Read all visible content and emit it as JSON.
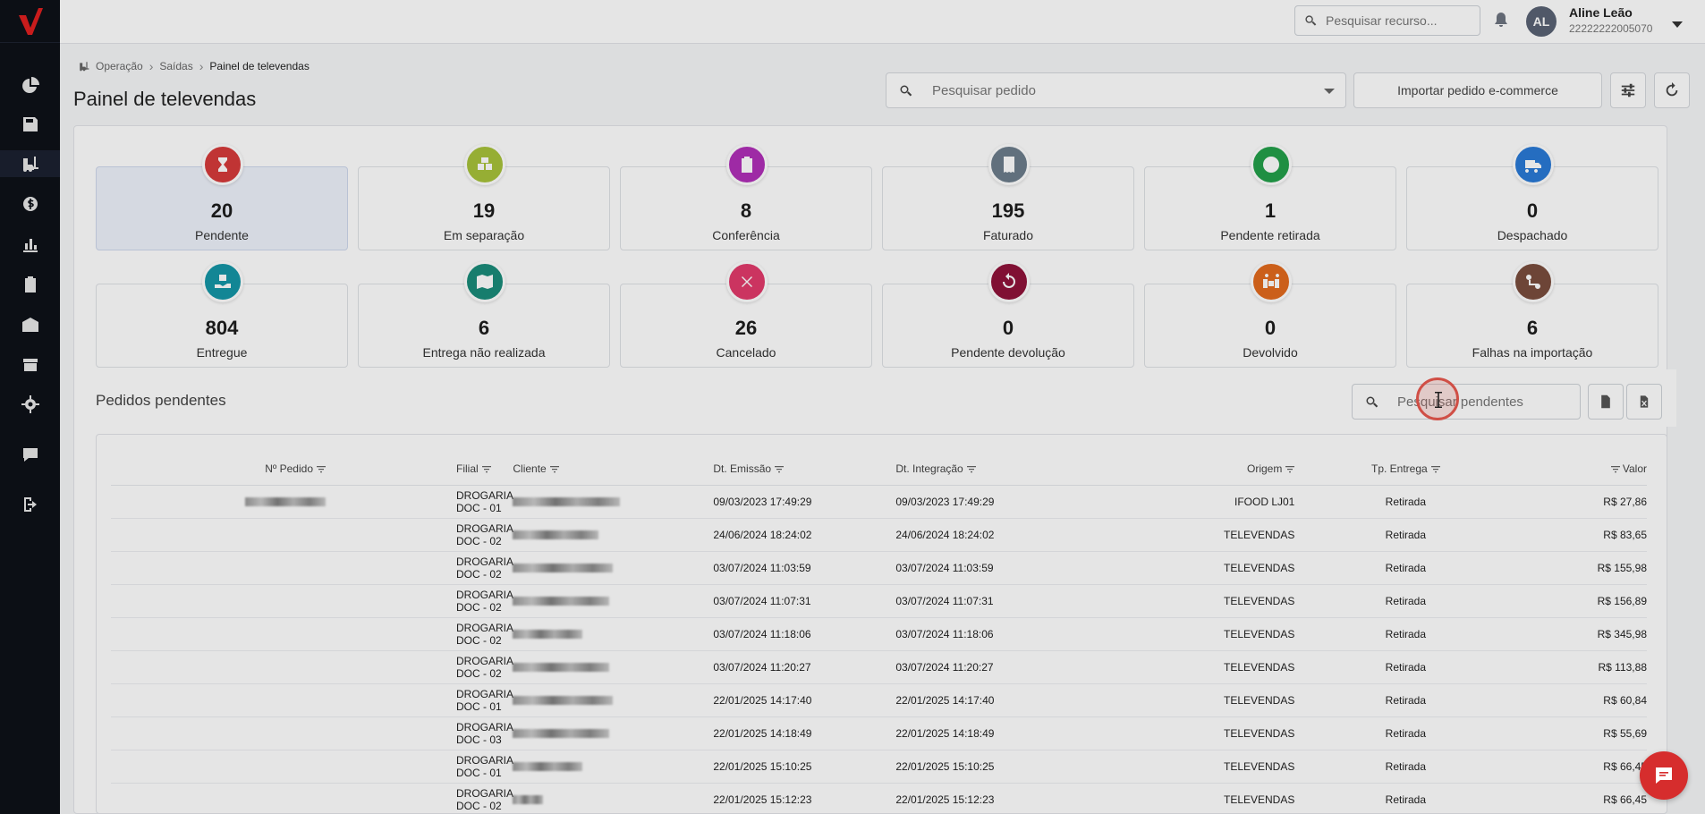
{
  "header": {
    "search_placeholder": "Pesquisar recurso...",
    "user": {
      "initials": "AL",
      "name": "Aline Leão",
      "id": "22222222005070"
    }
  },
  "breadcrumb": [
    "Operação",
    "Saídas",
    "Painel de televendas"
  ],
  "page": {
    "title": "Painel de televendas",
    "order_search_placeholder": "Pesquisar pedido",
    "import_label": "Importar pedido e-commerce"
  },
  "colors": {
    "pendente": "#d63a3a",
    "em_separacao": "#a8c23a",
    "conferencia": "#b02fb8",
    "faturado": "#6c7d8c",
    "pendente_retirada": "#23a04a",
    "despachado": "#2a7ad6",
    "entregue": "#1596a6",
    "entrega_nao_realizada": "#1a8c7a",
    "cancelado": "#e23a6b",
    "pendente_devolucao": "#8f1239",
    "devolvido": "#e36a1e",
    "falhas_importacao": "#7a4d3e",
    "chat": "#d62d2d"
  },
  "status_cards": [
    {
      "count": "20",
      "label": "Pendente",
      "icon": "hourglass-icon",
      "color": "#d63a3a"
    },
    {
      "count": "19",
      "label": "Em separação",
      "icon": "boxes-icon",
      "color": "#a8c23a"
    },
    {
      "count": "8",
      "label": "Conferência",
      "icon": "clipboard-icon",
      "color": "#b02fb8"
    },
    {
      "count": "195",
      "label": "Faturado",
      "icon": "receipt-icon",
      "color": "#6c7d8c"
    },
    {
      "count": "1",
      "label": "Pendente retirada",
      "icon": "clock-icon",
      "color": "#23a04a"
    },
    {
      "count": "0",
      "label": "Despachado",
      "icon": "truck-icon",
      "color": "#2a7ad6"
    },
    {
      "count": "804",
      "label": "Entregue",
      "icon": "hand-box-icon",
      "color": "#1596a6"
    },
    {
      "count": "6",
      "label": "Entrega não realizada",
      "icon": "map-icon",
      "color": "#1a8c7a"
    },
    {
      "count": "26",
      "label": "Cancelado",
      "icon": "cancel-icon",
      "color": "#e23a6b"
    },
    {
      "count": "0",
      "label": "Pendente devolução",
      "icon": "undo-icon",
      "color": "#8f1239"
    },
    {
      "count": "0",
      "label": "Devolvido",
      "icon": "people-box-icon",
      "color": "#e36a1e"
    },
    {
      "count": "6",
      "label": "Falhas na importação",
      "icon": "route-icon",
      "color": "#7a4d3e"
    }
  ],
  "pending": {
    "title": "Pedidos pendentes",
    "search_placeholder": "Pesquisar pendentes"
  },
  "table": {
    "columns": [
      "Nº Pedido",
      "Filial",
      "Cliente",
      "Dt. Emissão",
      "Dt. Integração",
      "Origem",
      "Tp. Entrega",
      "Valor"
    ],
    "rows": [
      {
        "filial": "DROGARIA DOC - 01",
        "emissao": "09/03/2023 17:49:29",
        "integracao": "09/03/2023 17:49:29",
        "origem": "IFOOD LJ01",
        "entrega": "Retirada",
        "valor": "R$ 27,86"
      },
      {
        "filial": "DROGARIA DOC - 02",
        "emissao": "24/06/2024 18:24:02",
        "integracao": "24/06/2024 18:24:02",
        "origem": "TELEVENDAS",
        "entrega": "Retirada",
        "valor": "R$ 83,65"
      },
      {
        "filial": "DROGARIA DOC - 02",
        "emissao": "03/07/2024 11:03:59",
        "integracao": "03/07/2024 11:03:59",
        "origem": "TELEVENDAS",
        "entrega": "Retirada",
        "valor": "R$ 155,98"
      },
      {
        "filial": "DROGARIA DOC - 02",
        "emissao": "03/07/2024 11:07:31",
        "integracao": "03/07/2024 11:07:31",
        "origem": "TELEVENDAS",
        "entrega": "Retirada",
        "valor": "R$ 156,89"
      },
      {
        "filial": "DROGARIA DOC - 02",
        "emissao": "03/07/2024 11:18:06",
        "integracao": "03/07/2024 11:18:06",
        "origem": "TELEVENDAS",
        "entrega": "Retirada",
        "valor": "R$ 345,98"
      },
      {
        "filial": "DROGARIA DOC - 02",
        "emissao": "03/07/2024 11:20:27",
        "integracao": "03/07/2024 11:20:27",
        "origem": "TELEVENDAS",
        "entrega": "Retirada",
        "valor": "R$ 113,88"
      },
      {
        "filial": "DROGARIA DOC - 01",
        "emissao": "22/01/2025 14:17:40",
        "integracao": "22/01/2025 14:17:40",
        "origem": "TELEVENDAS",
        "entrega": "Retirada",
        "valor": "R$ 60,84"
      },
      {
        "filial": "DROGARIA DOC - 03",
        "emissao": "22/01/2025 14:18:49",
        "integracao": "22/01/2025 14:18:49",
        "origem": "TELEVENDAS",
        "entrega": "Retirada",
        "valor": "R$ 55,69"
      },
      {
        "filial": "DROGARIA DOC - 01",
        "emissao": "22/01/2025 15:10:25",
        "integracao": "22/01/2025 15:10:25",
        "origem": "TELEVENDAS",
        "entrega": "Retirada",
        "valor": "R$ 66,45"
      },
      {
        "filial": "DROGARIA DOC - 02",
        "emissao": "22/01/2025 15:12:23",
        "integracao": "22/01/2025 15:12:23",
        "origem": "TELEVENDAS",
        "entrega": "Retirada",
        "valor": "R$ 66,45"
      }
    ]
  }
}
